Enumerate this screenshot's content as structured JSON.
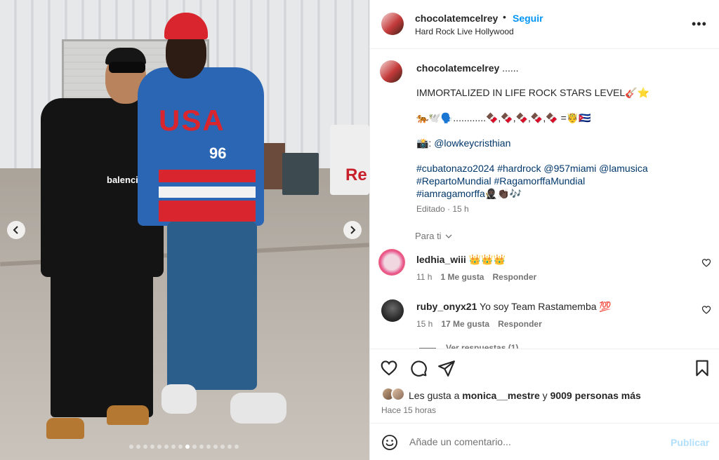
{
  "post": {
    "carousel": {
      "slide_count": 16,
      "active_index": 8,
      "shirt_text": "balencia",
      "jersey_text": "USA",
      "jersey_number": "96",
      "cart_text": "Re"
    },
    "header": {
      "username": "chocolatemcelrey",
      "separator": "•",
      "follow_label": "Seguir",
      "location": "Hard Rock Live Hollywood",
      "more_label": "•••"
    },
    "caption": {
      "username": "chocolatemcelrey",
      "username_suffix": " ......",
      "line1": "IMMORTALIZED IN LIFE ROCK STARS LEVEL🎸⭐",
      "line2": "🐅🕊️🗣️............🍫,🍫,🍫,🍫,🍫 =🤴🇨🇺",
      "camera_prefix": "📸: ",
      "camera_mention": "@lowkeycristhian",
      "tags_line1": "#cubatonazo2024 #hardrock @957miami @lamusica",
      "tags_line2": "#RepartoMundial #RagamorffaMundial",
      "tags_line3": "#iamragamorffa",
      "tags_line3_emoji": "🥷🏿👏🏿🎶",
      "edited": "Editado · 15 h"
    },
    "para_ti": "Para ti",
    "comments": [
      {
        "username": "ledhia_wiii",
        "text": "👑👑👑",
        "time": "11 h",
        "likes": "1 Me gusta",
        "reply": "Responder"
      },
      {
        "username": "ruby_onyx21",
        "text": "Yo soy Team Rastamemba 💯",
        "time": "15 h",
        "likes": "17 Me gusta",
        "reply": "Responder"
      }
    ],
    "see_replies": "Ver respuestas (1)",
    "likes": {
      "prefix": "Les gusta a ",
      "user": "monica__mestre",
      "middle": " y ",
      "others": "9009 personas más"
    },
    "time_ago": "Hace 15 horas",
    "add_comment": {
      "placeholder": "Añade un comentario...",
      "publish_label": "Publicar"
    }
  },
  "colors": {
    "accent": "#0095f6",
    "link": "#00376b",
    "muted": "#737373",
    "publish_disabled": "#b2dffc",
    "border": "#efefef"
  },
  "icons": [
    "chevron-left-icon",
    "chevron-right-icon",
    "more-icon",
    "chevron-down-icon",
    "heart-icon",
    "comment-icon",
    "share-icon",
    "bookmark-icon",
    "emoji-icon"
  ]
}
